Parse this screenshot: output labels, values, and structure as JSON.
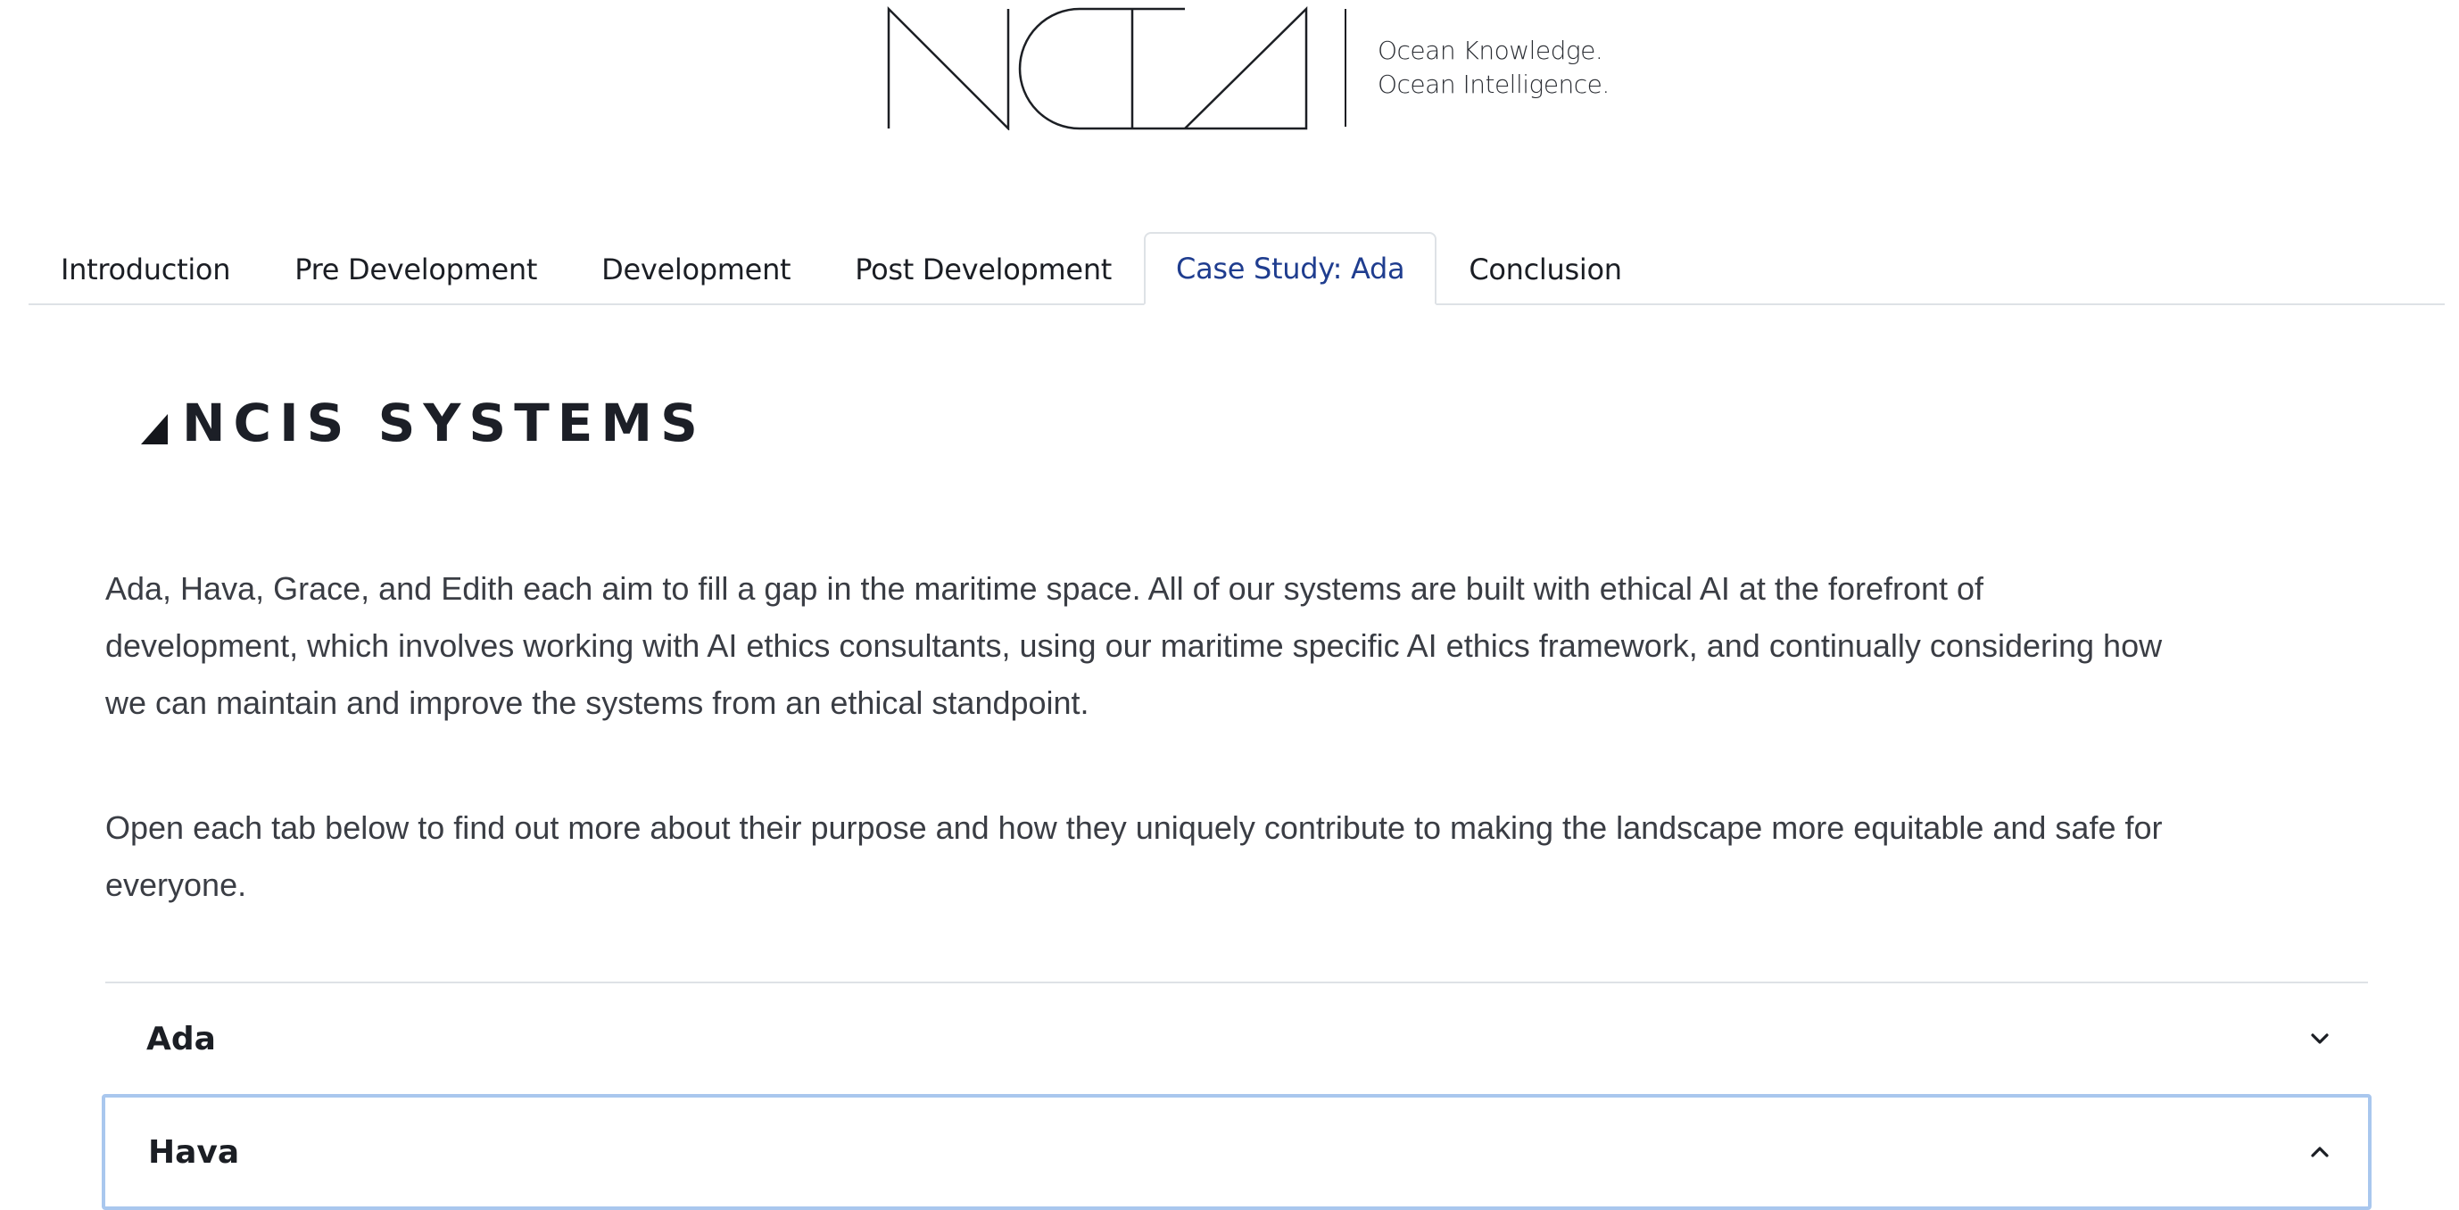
{
  "brand": {
    "logo_name": "NCIA",
    "tagline": [
      "Ocean Knowledge.",
      "Ocean Intelligence."
    ]
  },
  "tabs": [
    {
      "label": "Introduction",
      "active": false
    },
    {
      "label": "Pre Development",
      "active": false
    },
    {
      "label": "Development",
      "active": false
    },
    {
      "label": "Post Development",
      "active": false
    },
    {
      "label": "Case Study: Ada",
      "active": true
    },
    {
      "label": "Conclusion",
      "active": false
    }
  ],
  "section": {
    "heading": "NCIS SYSTEMS",
    "paragraphs": [
      "Ada, Hava, Grace, and Edith each aim to fill a gap in the maritime space. All of our systems are built with ethical AI at the forefront of development, which involves working with AI ethics consultants, using our maritime specific AI ethics framework, and continually considering how we can maintain and improve the systems from an ethical standpoint.",
      "Open each tab below to find out more about their purpose and how they uniquely contribute to making the landscape more equitable and safe for everyone."
    ]
  },
  "accordion": {
    "items": [
      {
        "title": "Ada",
        "open": false,
        "chevron": "chevron-down-icon"
      },
      {
        "title": "Hava",
        "open": true,
        "chevron": "chevron-up-icon"
      }
    ]
  },
  "colors": {
    "active_tab": "#1f3d8f",
    "focus_ring": "#a9c7ee",
    "text": "#3a3d44",
    "divider": "#dee2e6"
  }
}
